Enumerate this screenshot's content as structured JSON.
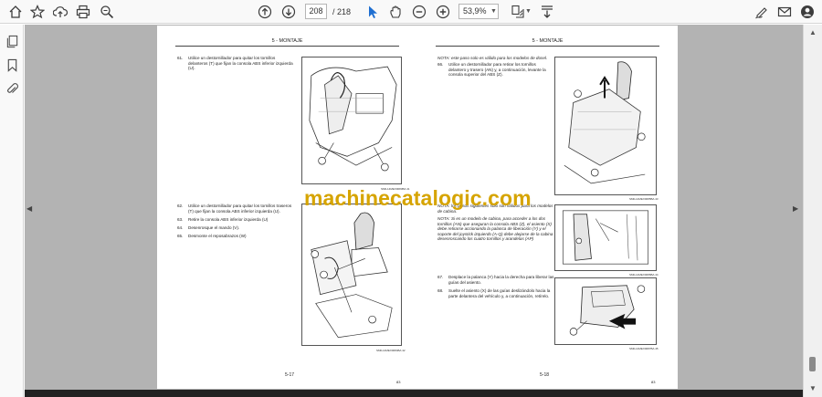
{
  "viewer": {
    "current_page": "208",
    "total_pages": "/ 218",
    "zoom": "53,9%"
  },
  "watermark": "machinecatalogic.com",
  "left_page": {
    "header": "5 - MONTAJE",
    "steps": [
      {
        "num": "61.",
        "text": "Utilice un destornillador para quitar los tornillos delanteros (T) que fijan la consola ABS inferior izquierda (U)."
      },
      {
        "num": "62.",
        "text": "Utilice un destornillador para quitar los tornillos traseros (T) que fijan la consola ABS inferior izquierda (U)."
      },
      {
        "num": "63.",
        "text": "Retire la consola ABS inferior izquierda (U)"
      },
      {
        "num": "64.",
        "text": "Desenrosque el mando (V)."
      },
      {
        "num": "65.",
        "text": "Desmonte el reposabrazos (W)"
      }
    ],
    "fig_codes": [
      "SMIL14MEX0083BA",
      "SMIL14MEX0084BA"
    ],
    "fig_nums": [
      "41",
      "42"
    ],
    "footer": "5-17",
    "footer_num": "83"
  },
  "right_page": {
    "header": "5 - MONTAJE",
    "note_top": "NOTA: este paso solo es válido para los modelos de dosel.",
    "steps": [
      {
        "num": "66.",
        "text": "Utilice un destornillador para retirar los tornillos delantero y trasero (AN) y, a continuación, levante la consola superior del ABS (Z)."
      },
      {
        "num": "67.",
        "text": "Desplace la palanca (Y) hacia la derecha para liberar las guías del asiento."
      },
      {
        "num": "68.",
        "text": "Suelte el asiento (X) de las guías deslizándolo hacia la parte delantera del vehículo y, a continuación, retírelo."
      }
    ],
    "note_mid_1": "NOTA: los pasos siguientes sólo son válidos para los modelos de cabina.",
    "note_mid_2": "NOTA: Si es un modelo de cabina, para acceder a los dos tornillos (AN) que aseguran la consola ABS (Z), el asiento (X) debe retirarse accionando la palanca de liberación (Y) y el soporte del joystick izquierdo (A-Q) debe alejarse de la cabina desenroscando los cuatro tornillos y arandelas (AP)",
    "fig_codes": [
      "SMIL14MEX0085BA",
      "SMIL14MEX0086BA",
      "SMIL14MEX0087BA"
    ],
    "fig_nums": [
      "43",
      "44",
      "45"
    ],
    "footer": "5-18",
    "footer_num": "83"
  }
}
